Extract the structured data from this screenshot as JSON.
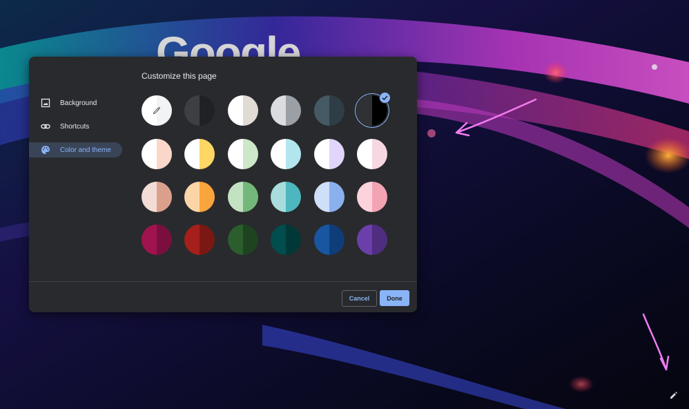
{
  "ntp": {
    "logo_text": "Google",
    "edit_button_icon": "pencil-icon"
  },
  "dialog": {
    "title": "Customize this page",
    "nav": [
      {
        "label": "Background",
        "icon": "image-icon",
        "selected": false
      },
      {
        "label": "Shortcuts",
        "icon": "link-icon",
        "selected": false
      },
      {
        "label": "Color and theme",
        "icon": "palette-icon",
        "selected": true
      }
    ],
    "cancel_label": "Cancel",
    "done_label": "Done"
  },
  "themes": [
    [
      {
        "name": "custom-color",
        "left": "#ffffff",
        "right": "#f1f3f4",
        "icon": "color-picker-icon"
      },
      {
        "name": "dark-gray",
        "left": "#3c4043",
        "right": "#202124"
      },
      {
        "name": "warm-gray",
        "left": "#ffffff",
        "right": "#e0dbd5"
      },
      {
        "name": "cool-gray",
        "left": "#dadce0",
        "right": "#9aa0a6"
      },
      {
        "name": "blue-gray",
        "left": "#455a64",
        "right": "#2f3e46"
      },
      {
        "name": "black",
        "left": "#303134",
        "right": "#000000",
        "selected": true
      }
    ],
    [
      {
        "name": "light-peach",
        "left": "#ffffff",
        "right": "#fbd7c9"
      },
      {
        "name": "light-yellow",
        "left": "#ffffff",
        "right": "#fdd663"
      },
      {
        "name": "light-green",
        "left": "#ffffff",
        "right": "#cce8c8"
      },
      {
        "name": "light-aqua",
        "left": "#ffffff",
        "right": "#b2e6ef"
      },
      {
        "name": "light-lavender",
        "left": "#ffffff",
        "right": "#e2d5fb"
      },
      {
        "name": "light-pink",
        "left": "#ffffff",
        "right": "#f6d7e2"
      }
    ],
    [
      {
        "name": "peach",
        "left": "#f3dcd6",
        "right": "#dba08c"
      },
      {
        "name": "orange",
        "left": "#fbd5a6",
        "right": "#f9a43d"
      },
      {
        "name": "green",
        "left": "#c3e2c2",
        "right": "#74b77a"
      },
      {
        "name": "aqua",
        "left": "#a9dcdc",
        "right": "#4db6be"
      },
      {
        "name": "sky-blue",
        "left": "#cfdff7",
        "right": "#8ab0ee"
      },
      {
        "name": "pink",
        "left": "#fcd3dc",
        "right": "#f3a4b4"
      }
    ],
    [
      {
        "name": "magenta",
        "left": "#a1134f",
        "right": "#7a0f3e"
      },
      {
        "name": "red",
        "left": "#a5201b",
        "right": "#7b1814"
      },
      {
        "name": "dark-green",
        "left": "#2b5e2c",
        "right": "#1d4320"
      },
      {
        "name": "dark-teal",
        "left": "#004d4d",
        "right": "#003838"
      },
      {
        "name": "dark-blue",
        "left": "#1856a1",
        "right": "#0f3d7a"
      },
      {
        "name": "violet",
        "left": "#6b3fa9",
        "right": "#4f2d80"
      }
    ]
  ],
  "colors": {
    "accent": "#8ab4f8",
    "dialog_bg": "#292a2d",
    "nav_selected_bg": "#394457",
    "text": "#e8eaed",
    "annotation": "#f27cf0"
  }
}
